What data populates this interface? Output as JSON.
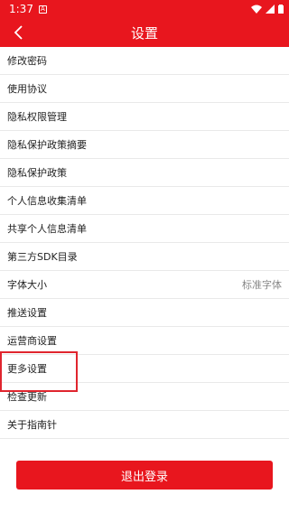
{
  "status_bar": {
    "time": "1:37",
    "app_badge": "A"
  },
  "header": {
    "title": "设置"
  },
  "items": [
    {
      "label": "修改密码",
      "value": ""
    },
    {
      "label": "使用协议",
      "value": ""
    },
    {
      "label": "隐私权限管理",
      "value": ""
    },
    {
      "label": "隐私保护政策摘要",
      "value": ""
    },
    {
      "label": "隐私保护政策",
      "value": ""
    },
    {
      "label": "个人信息收集清单",
      "value": ""
    },
    {
      "label": "共享个人信息清单",
      "value": ""
    },
    {
      "label": "第三方SDK目录",
      "value": ""
    },
    {
      "label": "字体大小",
      "value": "标准字体"
    },
    {
      "label": "推送设置",
      "value": ""
    },
    {
      "label": "运营商设置",
      "value": ""
    },
    {
      "label": "更多设置",
      "value": ""
    },
    {
      "label": "检查更新",
      "value": ""
    },
    {
      "label": "关于指南针",
      "value": ""
    }
  ],
  "logout_label": "退出登录",
  "colors": {
    "brand": "#e8161e",
    "highlight": "#e0252e"
  }
}
